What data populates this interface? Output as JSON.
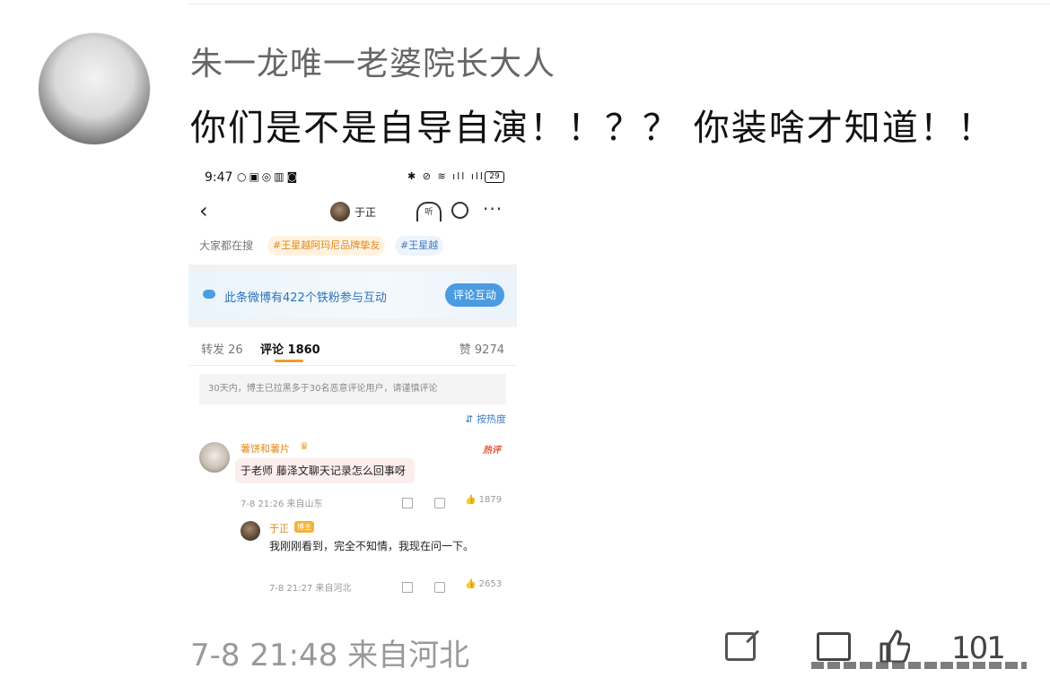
{
  "post": {
    "username": "朱一龙唯一老婆院长大人",
    "text": "你们是不是自导自演！！？？ 你装啥才知道！！",
    "footer_time": "7-8 21:48",
    "footer_location": "来自河北",
    "like_count": "101"
  },
  "screenshot": {
    "status_bar": {
      "time": "9:47",
      "battery": "29"
    },
    "nav": {
      "name": "于正",
      "listen_label": "听"
    },
    "hot_search": {
      "label": "大家都在搜",
      "chips": [
        "#王星越阿玛尼品牌挚友",
        "#王星越"
      ]
    },
    "banner": {
      "text": "此条微博有422个铁粉参与互动",
      "button": "评论互动"
    },
    "tabs": {
      "repost": "转发 26",
      "comments": "评论 1860",
      "likes": "赞 9274"
    },
    "notice": "30天内，博主已拉黑多于30名恶意评论用户，请谨慎评论",
    "sort": "按热度",
    "comment": {
      "name": "薯饼和薯片",
      "hot_badge": "热评",
      "text": "于老师 藤泽文聊天记录怎么回事呀",
      "time": "7-8 21:26",
      "location": "来自山东",
      "likes": "1879"
    },
    "reply": {
      "name": "于正",
      "badge": "博主",
      "text": "我刚刚看到，完全不知情，我现在问一下。",
      "time": "7-8 21:27",
      "location": "来自河北",
      "likes": "2653"
    }
  },
  "colors": {
    "accent_orange": "#e08a1e",
    "link_blue": "#3e7cc3",
    "banner_button": "#4b9be0"
  }
}
